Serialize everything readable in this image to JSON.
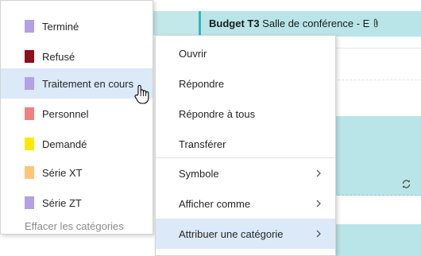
{
  "calendar": {
    "event_title_bold": "Budget T3",
    "event_title_rest": " Salle de conférence - E",
    "attachment_icon": "paperclip-icon",
    "recurrence_icon": "recurrence-icon",
    "event_color": "#b9e5e8"
  },
  "category_menu": {
    "items": [
      {
        "label": "Terminé",
        "color": "#b4a0e6"
      },
      {
        "label": "Refusé",
        "color": "#8b0f1c"
      },
      {
        "label": "Traitement en cours",
        "color": "#b4a0e6"
      },
      {
        "label": "Personnel",
        "color": "#f08080"
      },
      {
        "label": "Demandé",
        "color": "#ffe800"
      },
      {
        "label": "Série XT",
        "color": "#ffc57a"
      },
      {
        "label": "Série ZT",
        "color": "#b4a0e6"
      }
    ],
    "clear_label": "Effacer les catégories",
    "hovered_item": "Traitement en cours"
  },
  "context_menu": {
    "items": [
      {
        "label": "Ouvrir"
      },
      {
        "label": "Répondre"
      },
      {
        "label": "Répondre à tous"
      },
      {
        "label": "Transférer"
      },
      {
        "label": "Symbole",
        "submenu_icon": "chevron-right-icon"
      },
      {
        "label": "Afficher comme",
        "submenu_icon": "chevron-right-icon"
      },
      {
        "label": "Attribuer une catégorie",
        "submenu_icon": "chevron-right-icon"
      }
    ],
    "selected_item": "Attribuer une catégorie"
  },
  "colors": {
    "hover_highlight": "#dbe9f8",
    "event_accent": "#34b6c1"
  }
}
